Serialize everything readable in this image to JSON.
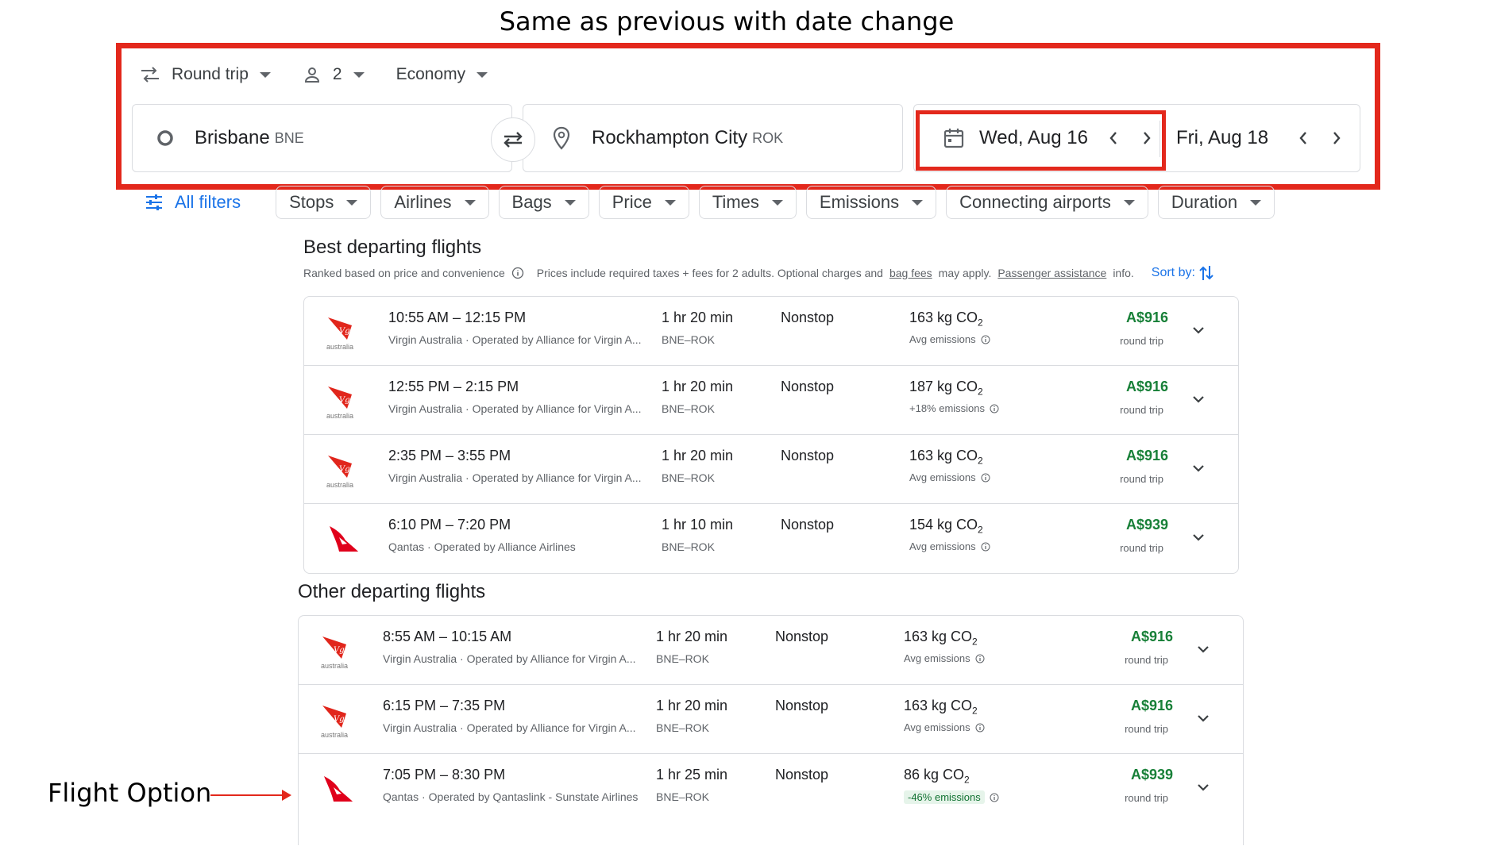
{
  "annotations": {
    "title": "Same as previous with date change",
    "flight_option_label": "Flight Option"
  },
  "search": {
    "trip_type": "Round trip",
    "passengers": "2",
    "cabin": "Economy",
    "origin_city": "Brisbane",
    "origin_code": "BNE",
    "destination_city": "Rockhampton City",
    "destination_code": "ROK",
    "depart_date": "Wed, Aug 16",
    "return_date": "Fri, Aug 18"
  },
  "filters": {
    "all_filters": "All filters",
    "chips": [
      "Stops",
      "Airlines",
      "Bags",
      "Price",
      "Times",
      "Emissions",
      "Connecting airports",
      "Duration"
    ]
  },
  "best": {
    "title": "Best departing flights",
    "ranked": "Ranked based on price and convenience",
    "prices_note_1": "Prices include required taxes + fees for 2 adults. Optional charges and",
    "bag_fees": "bag fees",
    "prices_note_2": "may apply.",
    "passenger_assistance": "Passenger assistance",
    "prices_note_3": "info.",
    "sort_by": "Sort by:",
    "flights": [
      {
        "times": "10:55 AM – 12:15 PM",
        "airline": "Virgin Australia · Operated by Alliance for Virgin A...",
        "duration": "1 hr 20 min",
        "route": "BNE–ROK",
        "stops": "Nonstop",
        "co2": "163 kg CO",
        "emissions": "Avg emissions",
        "price": "A$916",
        "price_type": "round trip",
        "logo": "virgin"
      },
      {
        "times": "12:55 PM – 2:15 PM",
        "airline": "Virgin Australia · Operated by Alliance for Virgin A...",
        "duration": "1 hr 20 min",
        "route": "BNE–ROK",
        "stops": "Nonstop",
        "co2": "187 kg CO",
        "emissions": "+18% emissions",
        "price": "A$916",
        "price_type": "round trip",
        "logo": "virgin"
      },
      {
        "times": "2:35 PM – 3:55 PM",
        "airline": "Virgin Australia · Operated by Alliance for Virgin A...",
        "duration": "1 hr 20 min",
        "route": "BNE–ROK",
        "stops": "Nonstop",
        "co2": "163 kg CO",
        "emissions": "Avg emissions",
        "price": "A$916",
        "price_type": "round trip",
        "logo": "virgin"
      },
      {
        "times": "6:10 PM – 7:20 PM",
        "airline": "Qantas · Operated by Alliance Airlines",
        "duration": "1 hr 10 min",
        "route": "BNE–ROK",
        "stops": "Nonstop",
        "co2": "154 kg CO",
        "emissions": "Avg emissions",
        "price": "A$939",
        "price_type": "round trip",
        "logo": "qantas"
      }
    ]
  },
  "other": {
    "title": "Other departing flights",
    "flights": [
      {
        "times": "8:55 AM – 10:15 AM",
        "airline": "Virgin Australia · Operated by Alliance for Virgin A...",
        "duration": "1 hr 20 min",
        "route": "BNE–ROK",
        "stops": "Nonstop",
        "co2": "163 kg CO",
        "emissions": "Avg emissions",
        "price": "A$916",
        "price_type": "round trip",
        "logo": "virgin"
      },
      {
        "times": "6:15 PM – 7:35 PM",
        "airline": "Virgin Australia · Operated by Alliance for Virgin A...",
        "duration": "1 hr 20 min",
        "route": "BNE–ROK",
        "stops": "Nonstop",
        "co2": "163 kg CO",
        "emissions": "Avg emissions",
        "price": "A$916",
        "price_type": "round trip",
        "logo": "virgin"
      },
      {
        "times": "7:05 PM – 8:30 PM",
        "airline": "Qantas · Operated by Qantaslink - Sunstate Airlines",
        "duration": "1 hr 25 min",
        "route": "BNE–ROK",
        "stops": "Nonstop",
        "co2": "86 kg CO",
        "emissions": "-46% emissions",
        "price": "A$939",
        "price_type": "round trip",
        "logo": "qantas",
        "good": true
      }
    ]
  },
  "colors": {
    "accent": "#1a73e8",
    "price": "#188038",
    "annotation": "#e3281c",
    "virgin": "#e1261c",
    "qantas": "#e0001b"
  }
}
